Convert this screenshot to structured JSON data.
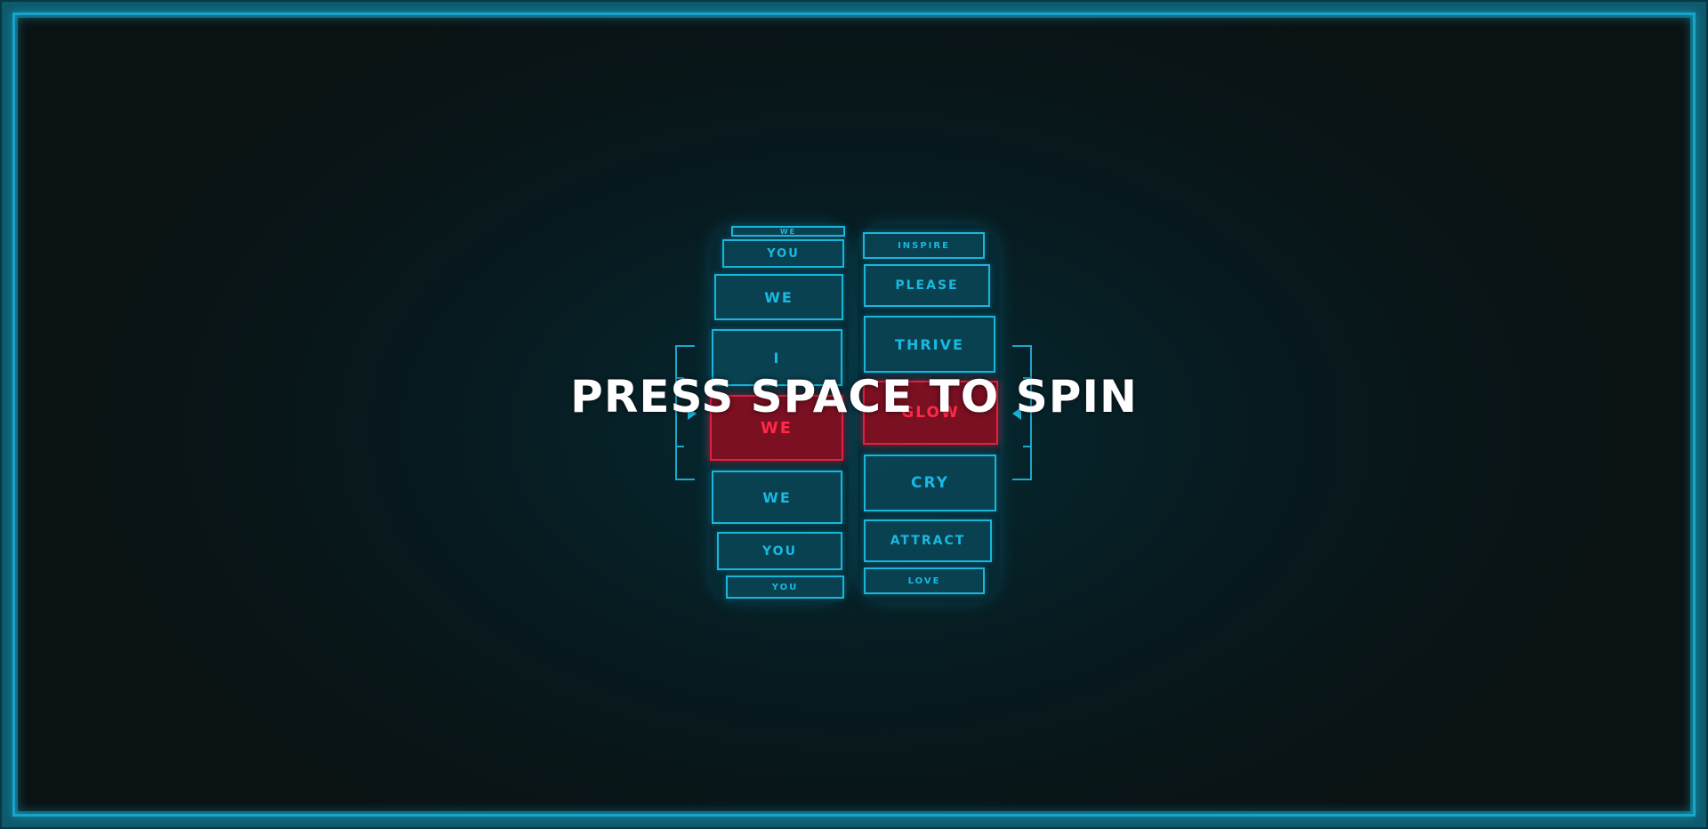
{
  "prompt": "PRESS SPACE TO SPIN",
  "colors": {
    "accent": "#19b6dc",
    "win": "#e51f3f",
    "frame": "#0f5a6c",
    "background": "#07191d"
  },
  "reels": [
    {
      "name": "subject-reel",
      "symbols": [
        "WE",
        "YOU",
        "WE",
        "I",
        "WE",
        "WE",
        "YOU",
        "YOU"
      ],
      "win_index": 4
    },
    {
      "name": "verb-reel",
      "symbols": [
        "INSPIRE",
        "PLEASE",
        "THRIVE",
        "GLOW",
        "CRY",
        "ATTRACT",
        "LOVE"
      ],
      "win_index": 3
    }
  ]
}
